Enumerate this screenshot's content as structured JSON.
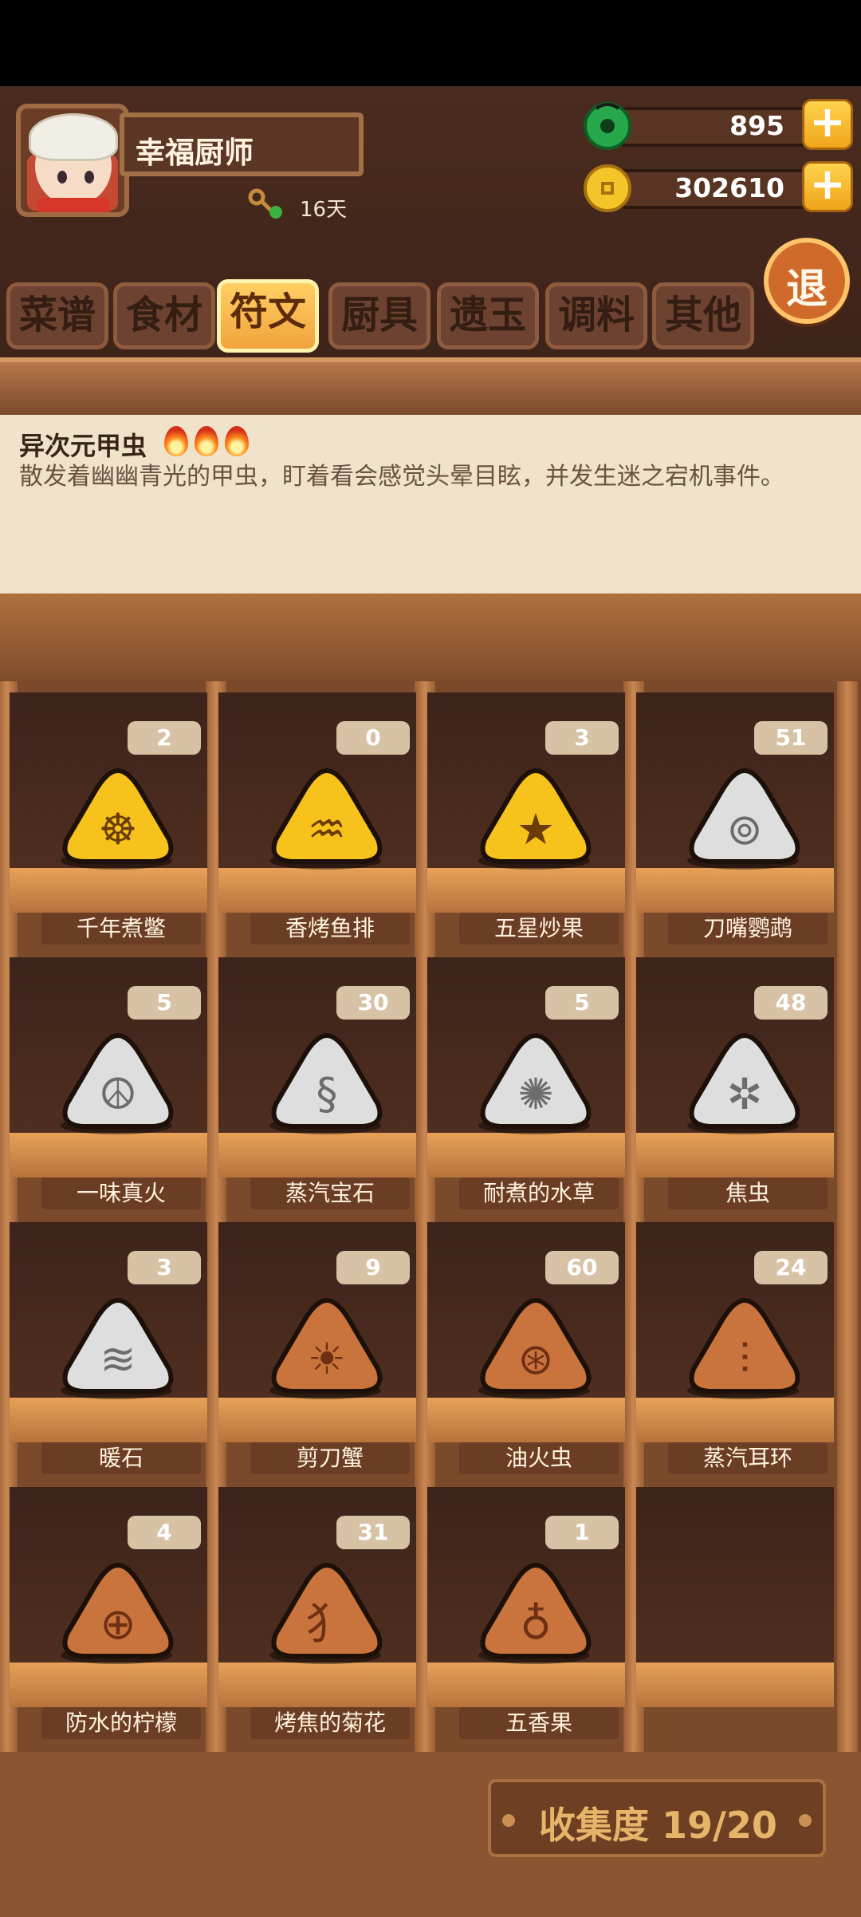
{
  "player": {
    "name": "幸福厨师",
    "days": "16天"
  },
  "currency": {
    "jade": "895",
    "coins": "302610"
  },
  "exit_label": "退",
  "tabs": [
    {
      "label": "菜谱",
      "active": false
    },
    {
      "label": "食材",
      "active": false
    },
    {
      "label": "符文",
      "active": true
    },
    {
      "label": "厨具",
      "active": false
    },
    {
      "label": "遗玉",
      "active": false
    },
    {
      "label": "调料",
      "active": false
    },
    {
      "label": "其他",
      "active": false
    }
  ],
  "description": {
    "title": "异次元甲虫",
    "text": "散发着幽幽青光的甲虫，盯着看会感觉头晕目眩，并发生迷之宕机事件。"
  },
  "runes": [
    {
      "name": "千年煮鳖",
      "count": "2",
      "tier": "gold"
    },
    {
      "name": "香烤鱼排",
      "count": "0",
      "tier": "gold"
    },
    {
      "name": "五星炒果",
      "count": "3",
      "tier": "gold"
    },
    {
      "name": "刀嘴鹦鹉",
      "count": "51",
      "tier": "silver"
    },
    {
      "name": "一味真火",
      "count": "5",
      "tier": "silver"
    },
    {
      "name": "蒸汽宝石",
      "count": "30",
      "tier": "silver"
    },
    {
      "name": "耐煮的水草",
      "count": "5",
      "tier": "silver"
    },
    {
      "name": "焦虫",
      "count": "48",
      "tier": "silver"
    },
    {
      "name": "暖石",
      "count": "3",
      "tier": "silver"
    },
    {
      "name": "剪刀蟹",
      "count": "9",
      "tier": "bronze"
    },
    {
      "name": "油火虫",
      "count": "60",
      "tier": "bronze"
    },
    {
      "name": "蒸汽耳环",
      "count": "24",
      "tier": "bronze"
    },
    {
      "name": "防水的柠檬",
      "count": "4",
      "tier": "bronze"
    },
    {
      "name": "烤焦的菊花",
      "count": "31",
      "tier": "bronze"
    },
    {
      "name": "五香果",
      "count": "1",
      "tier": "bronze"
    }
  ],
  "tier_colors": {
    "gold": "#f7c21c",
    "silver": "#dedede",
    "bronze": "#c9743d"
  },
  "collection": "收集度 19/20"
}
